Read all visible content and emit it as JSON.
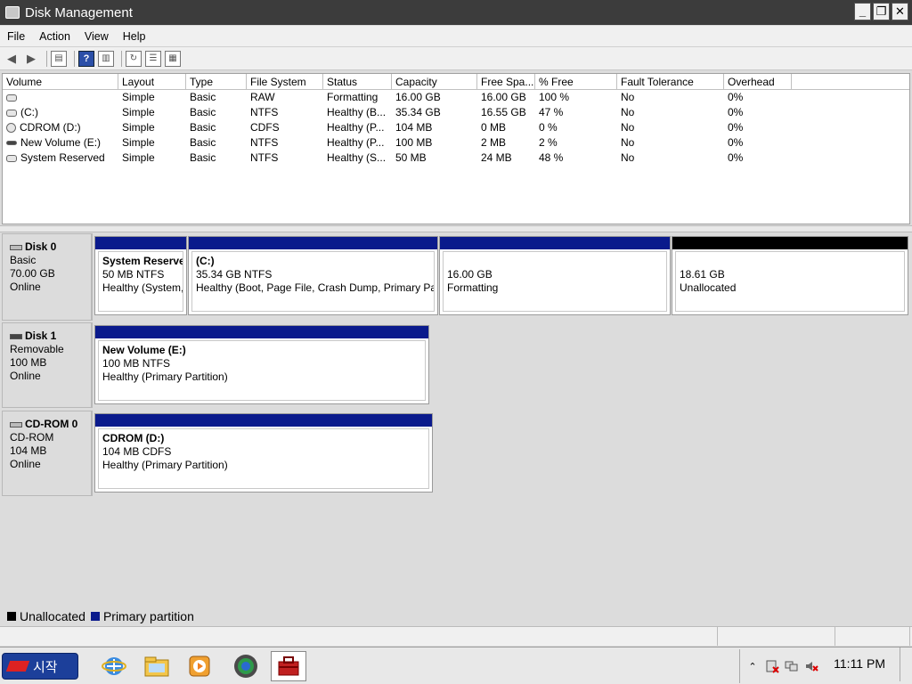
{
  "window": {
    "title": "Disk Management"
  },
  "menu": [
    "File",
    "Action",
    "View",
    "Help"
  ],
  "volume_list": {
    "columns": [
      "Volume",
      "Layout",
      "Type",
      "File System",
      "Status",
      "Capacity",
      "Free Spa...",
      "% Free",
      "Fault Tolerance",
      "Overhead"
    ],
    "rows": [
      {
        "icon": "disk-icon",
        "cells": [
          "",
          "Simple",
          "Basic",
          "RAW",
          "Formatting",
          "16.00 GB",
          "16.00 GB",
          "100 %",
          "No",
          "0%"
        ]
      },
      {
        "icon": "disk-icon",
        "cells": [
          "(C:)",
          "Simple",
          "Basic",
          "NTFS",
          "Healthy (B...",
          "35.34 GB",
          "16.55 GB",
          "47 %",
          "No",
          "0%"
        ]
      },
      {
        "icon": "cdrom-icon",
        "cells": [
          "CDROM (D:)",
          "Simple",
          "Basic",
          "CDFS",
          "Healthy (P...",
          "104 MB",
          "0 MB",
          "0 %",
          "No",
          "0%"
        ]
      },
      {
        "icon": "removable-disk-icon",
        "cells": [
          "New Volume (E:)",
          "Simple",
          "Basic",
          "NTFS",
          "Healthy (P...",
          "100 MB",
          "2 MB",
          "2 %",
          "No",
          "0%"
        ]
      },
      {
        "icon": "disk-icon",
        "cells": [
          "System Reserved",
          "Simple",
          "Basic",
          "NTFS",
          "Healthy (S...",
          "50 MB",
          "24 MB",
          "48 %",
          "No",
          "0%"
        ]
      }
    ]
  },
  "disks": [
    {
      "name": "Disk 0",
      "type": "Basic",
      "size": "70.00 GB",
      "state": "Online",
      "partitions": [
        {
          "title": "System Reserve",
          "size": "50 MB NTFS",
          "status": "Healthy (System,",
          "bar": "primary"
        },
        {
          "title": "(C:)",
          "size": "35.34 GB NTFS",
          "status": "Healthy (Boot, Page File, Crash Dump, Primary Par",
          "bar": "primary"
        },
        {
          "title": "",
          "size": "16.00 GB",
          "status": "Formatting",
          "bar": "primary"
        },
        {
          "title": "",
          "size": "18.61 GB",
          "status": "Unallocated",
          "bar": "unallocated"
        }
      ]
    },
    {
      "name": "Disk 1",
      "type": "Removable",
      "size": "100 MB",
      "state": "Online",
      "partitions": [
        {
          "title": "New Volume  (E:)",
          "size": "100 MB NTFS",
          "status": "Healthy (Primary Partition)",
          "bar": "primary"
        }
      ]
    },
    {
      "name": "CD-ROM 0",
      "type": "CD-ROM",
      "size": "104 MB",
      "state": "Online",
      "partitions": [
        {
          "title": "CDROM  (D:)",
          "size": "104 MB CDFS",
          "status": "Healthy (Primary Partition)",
          "bar": "primary"
        }
      ]
    }
  ],
  "legend": [
    {
      "label": "Unallocated",
      "color": "#000000"
    },
    {
      "label": "Primary partition",
      "color": "#0a1a8c"
    }
  ],
  "taskbar": {
    "start_label": "시작",
    "clock": "11:11 PM"
  }
}
